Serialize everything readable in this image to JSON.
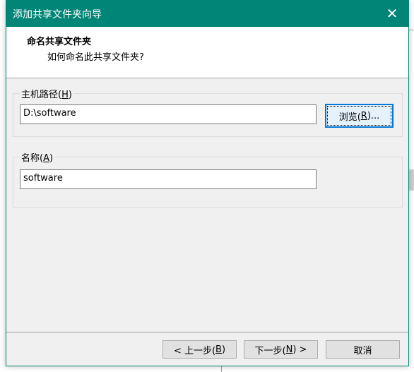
{
  "dialog": {
    "title": "添加共享文件夹向导",
    "close_icon": "close-icon"
  },
  "header": {
    "title": "命名共享文件夹",
    "subtitle": "如何命名此共享文件夹?"
  },
  "host_path": {
    "label": "主机路径(",
    "key": "H",
    "label_end": ")",
    "value": "D:\\software",
    "browse_label": "浏览(",
    "browse_key": "R",
    "browse_end": ")..."
  },
  "name": {
    "label": "名称(",
    "key": "A",
    "label_end": ")",
    "value": "software"
  },
  "footer": {
    "back_label": "< 上一步(",
    "back_key": "B",
    "back_end": ")",
    "next_label": "下一步(",
    "next_key": "N",
    "next_end": ") >",
    "cancel_label": "取消"
  },
  "colors": {
    "accent": "#008577",
    "focus": "#0078d7"
  }
}
